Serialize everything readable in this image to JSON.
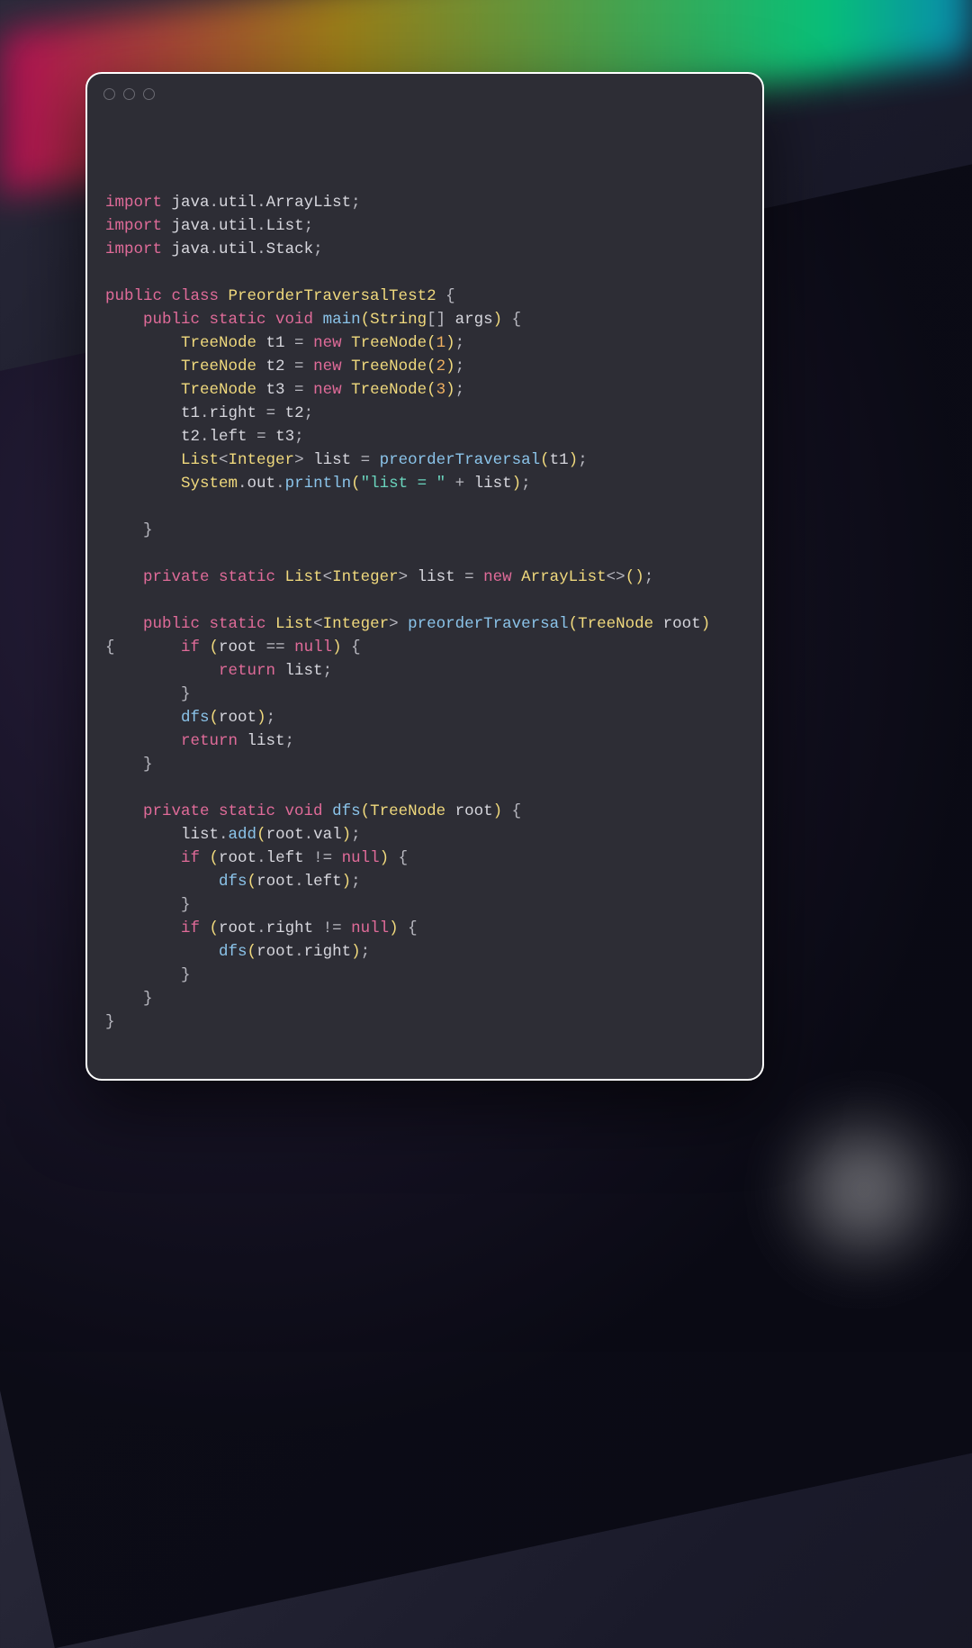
{
  "window": {
    "traffic_lights": [
      "close",
      "minimize",
      "zoom"
    ]
  },
  "code": {
    "lines": [
      [
        [
          "kw-import",
          "import "
        ],
        [
          "ident",
          "java"
        ],
        [
          "punct",
          "."
        ],
        [
          "ident",
          "util"
        ],
        [
          "punct",
          "."
        ],
        [
          "ident",
          "ArrayList"
        ],
        [
          "punct",
          ";"
        ]
      ],
      [
        [
          "kw-import",
          "import "
        ],
        [
          "ident",
          "java"
        ],
        [
          "punct",
          "."
        ],
        [
          "ident",
          "util"
        ],
        [
          "punct",
          "."
        ],
        [
          "ident",
          "List"
        ],
        [
          "punct",
          ";"
        ]
      ],
      [
        [
          "kw-import",
          "import "
        ],
        [
          "ident",
          "java"
        ],
        [
          "punct",
          "."
        ],
        [
          "ident",
          "util"
        ],
        [
          "punct",
          "."
        ],
        [
          "ident",
          "Stack"
        ],
        [
          "punct",
          ";"
        ]
      ],
      [],
      [
        [
          "kw-access",
          "public "
        ],
        [
          "kw-class",
          "class "
        ],
        [
          "type",
          "PreorderTraversalTest2"
        ],
        [
          "punct",
          " {"
        ]
      ],
      [
        [
          "ident",
          "    "
        ],
        [
          "kw-access",
          "public "
        ],
        [
          "kw-static",
          "static "
        ],
        [
          "kw-void",
          "void "
        ],
        [
          "method-decl",
          "main"
        ],
        [
          "paren",
          "("
        ],
        [
          "type",
          "String"
        ],
        [
          "punct",
          "[] "
        ],
        [
          "ident",
          "args"
        ],
        [
          "paren",
          ")"
        ],
        [
          "punct",
          " {"
        ]
      ],
      [
        [
          "ident",
          "        "
        ],
        [
          "type",
          "TreeNode"
        ],
        [
          "ident",
          " t1 "
        ],
        [
          "punct",
          "= "
        ],
        [
          "kw-new",
          "new "
        ],
        [
          "type",
          "TreeNode"
        ],
        [
          "paren",
          "("
        ],
        [
          "number",
          "1"
        ],
        [
          "paren",
          ")"
        ],
        [
          "punct",
          ";"
        ]
      ],
      [
        [
          "ident",
          "        "
        ],
        [
          "type",
          "TreeNode"
        ],
        [
          "ident",
          " t2 "
        ],
        [
          "punct",
          "= "
        ],
        [
          "kw-new",
          "new "
        ],
        [
          "type",
          "TreeNode"
        ],
        [
          "paren",
          "("
        ],
        [
          "number",
          "2"
        ],
        [
          "paren",
          ")"
        ],
        [
          "punct",
          ";"
        ]
      ],
      [
        [
          "ident",
          "        "
        ],
        [
          "type",
          "TreeNode"
        ],
        [
          "ident",
          " t3 "
        ],
        [
          "punct",
          "= "
        ],
        [
          "kw-new",
          "new "
        ],
        [
          "type",
          "TreeNode"
        ],
        [
          "paren",
          "("
        ],
        [
          "number",
          "3"
        ],
        [
          "paren",
          ")"
        ],
        [
          "punct",
          ";"
        ]
      ],
      [
        [
          "ident",
          "        t1"
        ],
        [
          "punct",
          "."
        ],
        [
          "ident",
          "right "
        ],
        [
          "punct",
          "= "
        ],
        [
          "ident",
          "t2"
        ],
        [
          "punct",
          ";"
        ]
      ],
      [
        [
          "ident",
          "        t2"
        ],
        [
          "punct",
          "."
        ],
        [
          "ident",
          "left "
        ],
        [
          "punct",
          "= "
        ],
        [
          "ident",
          "t3"
        ],
        [
          "punct",
          ";"
        ]
      ],
      [
        [
          "ident",
          "        "
        ],
        [
          "type",
          "List"
        ],
        [
          "punct",
          "<"
        ],
        [
          "type",
          "Integer"
        ],
        [
          "punct",
          "> "
        ],
        [
          "ident",
          "list "
        ],
        [
          "punct",
          "= "
        ],
        [
          "method-call",
          "preorderTraversal"
        ],
        [
          "paren",
          "("
        ],
        [
          "ident",
          "t1"
        ],
        [
          "paren",
          ")"
        ],
        [
          "punct",
          ";"
        ]
      ],
      [
        [
          "ident",
          "        "
        ],
        [
          "type",
          "System"
        ],
        [
          "punct",
          "."
        ],
        [
          "ident",
          "out"
        ],
        [
          "punct",
          "."
        ],
        [
          "method-call",
          "println"
        ],
        [
          "paren",
          "("
        ],
        [
          "string",
          "\"list = \""
        ],
        [
          "punct",
          " + "
        ],
        [
          "ident",
          "list"
        ],
        [
          "paren",
          ")"
        ],
        [
          "punct",
          ";"
        ]
      ],
      [],
      [
        [
          "punct",
          "    }"
        ]
      ],
      [],
      [
        [
          "ident",
          "    "
        ],
        [
          "kw-access",
          "private "
        ],
        [
          "kw-static",
          "static "
        ],
        [
          "type",
          "List"
        ],
        [
          "punct",
          "<"
        ],
        [
          "type",
          "Integer"
        ],
        [
          "punct",
          "> "
        ],
        [
          "ident",
          "list "
        ],
        [
          "punct",
          "= "
        ],
        [
          "kw-new",
          "new "
        ],
        [
          "type",
          "ArrayList"
        ],
        [
          "punct",
          "<>"
        ],
        [
          "paren",
          "("
        ],
        [
          "paren",
          ")"
        ],
        [
          "punct",
          ";"
        ]
      ],
      [],
      [
        [
          "ident",
          "    "
        ],
        [
          "kw-access",
          "public "
        ],
        [
          "kw-static",
          "static "
        ],
        [
          "type",
          "List"
        ],
        [
          "punct",
          "<"
        ],
        [
          "type",
          "Integer"
        ],
        [
          "punct",
          "> "
        ],
        [
          "method-decl",
          "preorderTraversal"
        ],
        [
          "paren",
          "("
        ],
        [
          "type",
          "TreeNode"
        ],
        [
          "ident",
          " root"
        ],
        [
          "paren",
          ")"
        ],
        [
          "punct",
          " "
        ]
      ],
      [
        [
          "punct",
          "{       "
        ],
        [
          "kw-control",
          "if "
        ],
        [
          "paren",
          "("
        ],
        [
          "ident",
          "root "
        ],
        [
          "punct",
          "== "
        ],
        [
          "kw-null",
          "null"
        ],
        [
          "paren",
          ")"
        ],
        [
          "punct",
          " {"
        ]
      ],
      [
        [
          "ident",
          "            "
        ],
        [
          "kw-control",
          "return "
        ],
        [
          "ident",
          "list"
        ],
        [
          "punct",
          ";"
        ]
      ],
      [
        [
          "punct",
          "        }"
        ]
      ],
      [
        [
          "ident",
          "        "
        ],
        [
          "method-call",
          "dfs"
        ],
        [
          "paren",
          "("
        ],
        [
          "ident",
          "root"
        ],
        [
          "paren",
          ")"
        ],
        [
          "punct",
          ";"
        ]
      ],
      [
        [
          "ident",
          "        "
        ],
        [
          "kw-control",
          "return "
        ],
        [
          "ident",
          "list"
        ],
        [
          "punct",
          ";"
        ]
      ],
      [
        [
          "punct",
          "    }"
        ]
      ],
      [],
      [
        [
          "ident",
          "    "
        ],
        [
          "kw-access",
          "private "
        ],
        [
          "kw-static",
          "static "
        ],
        [
          "kw-void",
          "void "
        ],
        [
          "method-decl",
          "dfs"
        ],
        [
          "paren",
          "("
        ],
        [
          "type",
          "TreeNode"
        ],
        [
          "ident",
          " root"
        ],
        [
          "paren",
          ")"
        ],
        [
          "punct",
          " {"
        ]
      ],
      [
        [
          "ident",
          "        list"
        ],
        [
          "punct",
          "."
        ],
        [
          "method-call",
          "add"
        ],
        [
          "paren",
          "("
        ],
        [
          "ident",
          "root"
        ],
        [
          "punct",
          "."
        ],
        [
          "ident",
          "val"
        ],
        [
          "paren",
          ")"
        ],
        [
          "punct",
          ";"
        ]
      ],
      [
        [
          "ident",
          "        "
        ],
        [
          "kw-control",
          "if "
        ],
        [
          "paren",
          "("
        ],
        [
          "ident",
          "root"
        ],
        [
          "punct",
          "."
        ],
        [
          "ident",
          "left "
        ],
        [
          "punct",
          "!= "
        ],
        [
          "kw-null",
          "null"
        ],
        [
          "paren",
          ")"
        ],
        [
          "punct",
          " {"
        ]
      ],
      [
        [
          "ident",
          "            "
        ],
        [
          "method-call",
          "dfs"
        ],
        [
          "paren",
          "("
        ],
        [
          "ident",
          "root"
        ],
        [
          "punct",
          "."
        ],
        [
          "ident",
          "left"
        ],
        [
          "paren",
          ")"
        ],
        [
          "punct",
          ";"
        ]
      ],
      [
        [
          "punct",
          "        }"
        ]
      ],
      [
        [
          "ident",
          "        "
        ],
        [
          "kw-control",
          "if "
        ],
        [
          "paren",
          "("
        ],
        [
          "ident",
          "root"
        ],
        [
          "punct",
          "."
        ],
        [
          "ident",
          "right "
        ],
        [
          "punct",
          "!= "
        ],
        [
          "kw-null",
          "null"
        ],
        [
          "paren",
          ")"
        ],
        [
          "punct",
          " {"
        ]
      ],
      [
        [
          "ident",
          "            "
        ],
        [
          "method-call",
          "dfs"
        ],
        [
          "paren",
          "("
        ],
        [
          "ident",
          "root"
        ],
        [
          "punct",
          "."
        ],
        [
          "ident",
          "right"
        ],
        [
          "paren",
          ")"
        ],
        [
          "punct",
          ";"
        ]
      ],
      [
        [
          "punct",
          "        }"
        ]
      ],
      [
        [
          "punct",
          "    }"
        ]
      ],
      [
        [
          "punct",
          "}"
        ]
      ]
    ]
  }
}
